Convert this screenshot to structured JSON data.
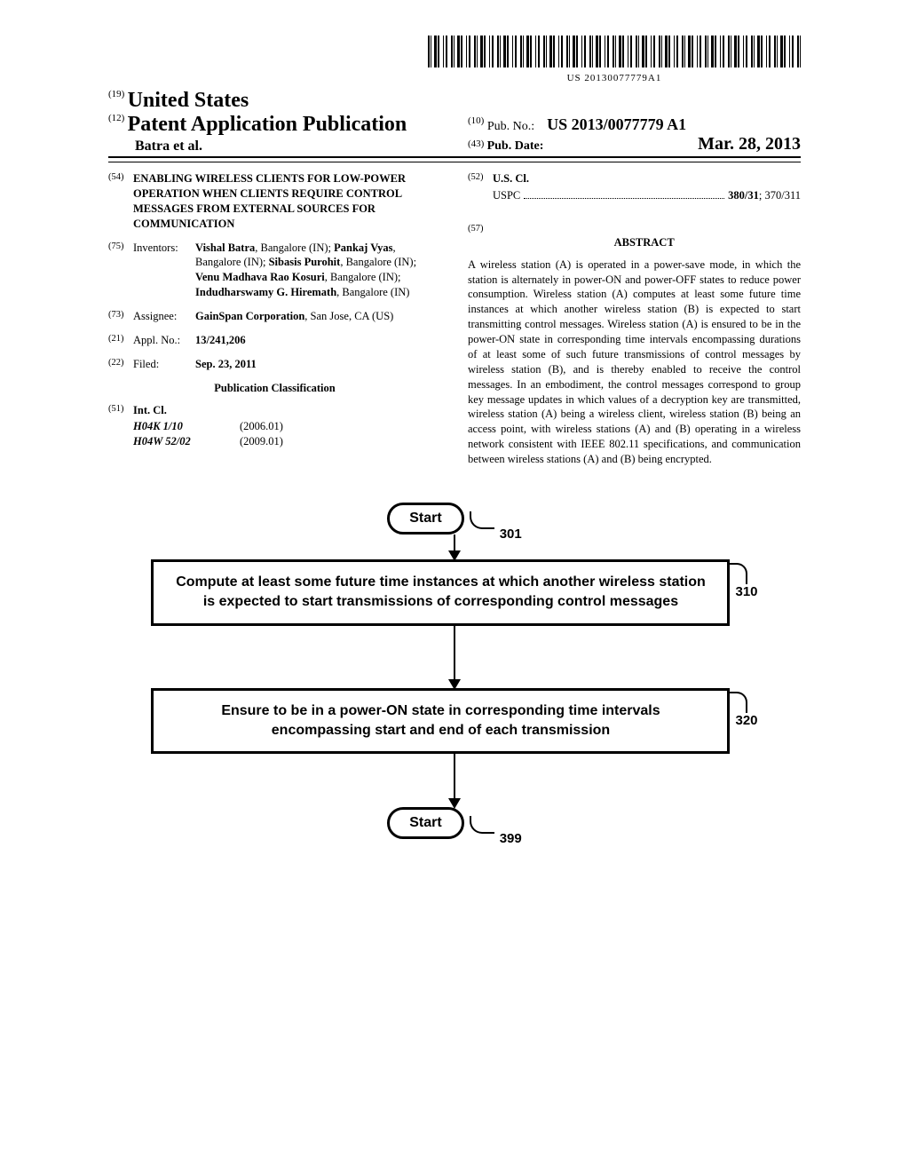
{
  "barcode": {
    "text": "US 20130077779A1"
  },
  "header": {
    "country_num": "(19)",
    "country": "United States",
    "doc_type_num": "(12)",
    "doc_type": "Patent Application Publication",
    "authors": "Batra et al.",
    "pub_no_num": "(10)",
    "pub_no_label": "Pub. No.:",
    "pub_no_value": "US 2013/0077779 A1",
    "pub_date_num": "(43)",
    "pub_date_label": "Pub. Date:",
    "pub_date_value": "Mar. 28, 2013"
  },
  "left_col": {
    "title_num": "(54)",
    "title": "ENABLING WIRELESS CLIENTS FOR LOW-POWER OPERATION WHEN CLIENTS REQUIRE CONTROL MESSAGES FROM EXTERNAL SOURCES FOR COMMUNICATION",
    "inventors_num": "(75)",
    "inventors_label": "Inventors:",
    "inventors_html": "Vishal Batra, Bangalore (IN); Pankaj Vyas, Bangalore (IN); Sibasis Purohit, Bangalore (IN); Venu Madhava Rao Kosuri, Bangalore (IN); Indudharswamy G. Hiremath, Bangalore (IN)",
    "assignee_num": "(73)",
    "assignee_label": "Assignee:",
    "assignee_value": "GainSpan Corporation, San Jose, CA (US)",
    "appl_num": "(21)",
    "appl_label": "Appl. No.:",
    "appl_value": "13/241,206",
    "filed_num": "(22)",
    "filed_label": "Filed:",
    "filed_value": "Sep. 23, 2011",
    "class_heading": "Publication Classification",
    "intcl_num": "(51)",
    "intcl_label": "Int. Cl.",
    "intcl_rows": [
      {
        "code": "H04K 1/10",
        "year": "(2006.01)"
      },
      {
        "code": "H04W 52/02",
        "year": "(2009.01)"
      }
    ]
  },
  "right_col": {
    "uscl_num": "(52)",
    "uscl_label": "U.S. Cl.",
    "uscl_prefix": "USPC",
    "uscl_value": "380/31; 370/311",
    "abstract_num": "(57)",
    "abstract_heading": "ABSTRACT",
    "abstract_text": "A wireless station (A) is operated in a power-save mode, in which the station is alternately in power-ON and power-OFF states to reduce power consumption. Wireless station (A) computes at least some future time instances at which another wireless station (B) is expected to start transmitting control messages. Wireless station (A) is ensured to be in the power-ON state in corresponding time intervals encompassing durations of at least some of such future transmissions of control messages by wireless station (B), and is thereby enabled to receive the control messages. In an embodiment, the control messages correspond to group key message updates in which values of a decryption key are transmitted, wireless station (A) being a wireless client, wireless station (B) being an access point, with wireless stations (A) and (B) operating in a wireless network consistent with IEEE 802.11 specifications, and communication between wireless stations (A) and (B) being encrypted."
  },
  "flowchart": {
    "start1": {
      "label": "Start",
      "ref": "301"
    },
    "step1": {
      "text": "Compute at least some future time instances at which another wireless station is expected to start transmissions of corresponding control messages",
      "ref": "310"
    },
    "step2": {
      "text": "Ensure to be in a power-ON state in corresponding time intervals encompassing start and end of each transmission",
      "ref": "320"
    },
    "start2": {
      "label": "Start",
      "ref": "399"
    }
  }
}
